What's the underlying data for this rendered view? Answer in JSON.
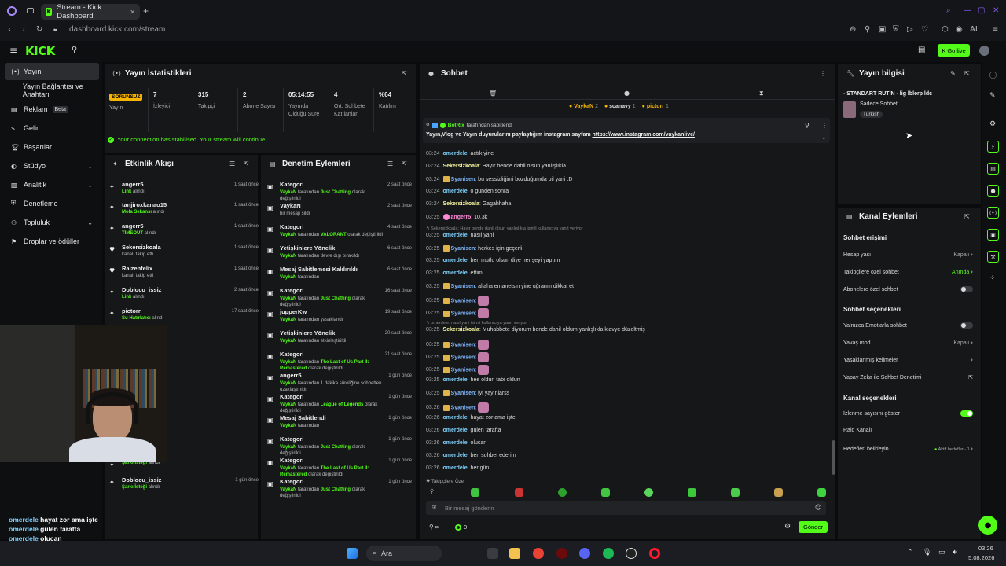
{
  "browser": {
    "tab_title": "Stream - Kick Dashboard",
    "url": "dashboard.kick.com/stream",
    "ai_label": "AI"
  },
  "header": {
    "logo": "KICK",
    "go_live": "Go live"
  },
  "sidebar": {
    "items": [
      {
        "label": "Yayın",
        "icon": "broadcast-icon",
        "active": true
      },
      {
        "label": "Yayın Bağlantısı ve Anahtarı",
        "icon": ""
      },
      {
        "label": "Reklam",
        "icon": "ad-icon",
        "badge": "Beta"
      },
      {
        "label": "Gelir",
        "icon": "revenue-icon"
      },
      {
        "label": "Başarılar",
        "icon": "trophy-icon"
      },
      {
        "label": "Stüdyo",
        "icon": "palette-icon",
        "chevron": true
      },
      {
        "label": "Analitik",
        "icon": "chart-icon",
        "chevron": true
      },
      {
        "label": "Denetleme",
        "icon": "shield-icon"
      },
      {
        "label": "Topluluk",
        "icon": "users-icon",
        "chevron": true
      },
      {
        "label": "Droplar ve ödüller",
        "icon": "gift-icon"
      }
    ]
  },
  "stats": {
    "title": "Yayın İstatistikleri",
    "status_badge": "SORUNSUZ",
    "status_label": "Yayın",
    "items": [
      {
        "value": "7",
        "label": "İzleyici"
      },
      {
        "value": "315",
        "label": "Takipçi"
      },
      {
        "value": "2",
        "label": "Abone Sayısı"
      },
      {
        "value": "05:14:55",
        "label": "Yayında Olduğu Süre"
      },
      {
        "value": "4",
        "label": "Ort. Sohbete Katılanlar"
      },
      {
        "value": "%64",
        "label": "Katılım"
      }
    ],
    "connection_msg": "Your connection has stabilised. Your stream will continue."
  },
  "activity": {
    "title": "Etkinlik Akışı",
    "items": [
      {
        "name": "angerr5",
        "b": "Link",
        "rest": " alındı",
        "time": "1 saat önce"
      },
      {
        "name": "tanjiroxkanao15",
        "b": "Mola Sekansı",
        "rest": " alındı",
        "time": "1 saat önce"
      },
      {
        "name": "angerr5",
        "b": "TIMEOUT",
        "rest": " alındı",
        "time": "1 saat önce"
      },
      {
        "name": "Sekersizkoala",
        "b": "",
        "rest": "kanalı takip etti",
        "time": "1 saat önce"
      },
      {
        "name": "Raizenfelix",
        "b": "",
        "rest": "kanalı takip etti",
        "time": "1 saat önce"
      },
      {
        "name": "Doblocu_issiz",
        "b": "Link",
        "rest": " alındı",
        "time": "2 saat önce"
      },
      {
        "name": "pictorr",
        "b": "Su Hatırlatıcı",
        "rest": " alındı",
        "time": "17 saat önce"
      },
      {
        "name": "",
        "b": "Şarkı İsteği",
        "rest": " alındı",
        "time": ""
      },
      {
        "name": "Doblocu_issiz",
        "b": "Şarkı İsteği",
        "rest": " alındı",
        "time": "1 gün önce"
      }
    ]
  },
  "moderation": {
    "title": "Denetim Eylemleri",
    "items": [
      {
        "name": "Kategori",
        "user": "VaykaN",
        "pre": " tarafından ",
        "b": "Just Chatting",
        "post": " olarak değiştirildi",
        "time": "2 saat önce"
      },
      {
        "name": "VaykaN",
        "user": "",
        "pre": "bir mesajı sildi",
        "b": "",
        "post": "",
        "time": "2 saat önce"
      },
      {
        "name": "Kategori",
        "user": "VaykaN",
        "pre": " tarafından ",
        "b": "VALORANT",
        "post": " olarak değiştirildi",
        "time": "4 saat önce"
      },
      {
        "name": "Yetişkinlere Yönelik",
        "user": "VaykaN",
        "pre": " tarafından devre dışı bırakıldı",
        "b": "",
        "post": "",
        "time": "6 saat önce"
      },
      {
        "name": "Mesaj Sabitlemesi Kaldırıldı",
        "user": "VaykaN",
        "pre": " tarafından",
        "b": "",
        "post": "",
        "time": "6 saat önce"
      },
      {
        "name": "Kategori",
        "user": "VaykaN",
        "pre": " tarafından ",
        "b": "Just Chatting",
        "post": " olarak değiştirildi",
        "time": "16 saat önce"
      },
      {
        "name": "jupperKw",
        "user": "VaykaN",
        "pre": " tarafından yasaklandı",
        "b": "",
        "post": "",
        "time": "19 saat önce"
      },
      {
        "name": "Yetişkinlere Yönelik",
        "user": "VaykaN",
        "pre": " tarafından etkinleştirildi",
        "b": "",
        "post": "",
        "time": "20 saat önce"
      },
      {
        "name": "Kategori",
        "user": "VaykaN",
        "pre": " tarafından ",
        "b": "The Last of Us Part II: Remastered",
        "post": " olarak değiştirildi",
        "time": "21 saat önce"
      },
      {
        "name": "angerr5",
        "user": "VaykaN",
        "pre": " tarafından 1 dakika süreliğine sohbetten uzaklaştırıldı",
        "b": "",
        "post": "",
        "time": "1 gün önce"
      },
      {
        "name": "Kategori",
        "user": "VaykaN",
        "pre": " tarafından ",
        "b": "League of Legends",
        "post": " olarak değiştirildi",
        "time": "1 gün önce"
      },
      {
        "name": "Mesaj Sabitlendi",
        "user": "VaykaN",
        "pre": " tarafından",
        "b": "",
        "post": "",
        "time": "1 gün önce"
      },
      {
        "name": "Kategori",
        "user": "VaykaN",
        "pre": " tarafından ",
        "b": "Just Chatting",
        "post": " olarak değiştirildi",
        "time": "1 gün önce"
      },
      {
        "name": "Kategori",
        "user": "VaykaN",
        "pre": " tarafından ",
        "b": "The Last of Us Part II: Remastered",
        "post": " olarak değiştirildi",
        "time": "1 gün önce"
      },
      {
        "name": "Kategori",
        "user": "VaykaN",
        "pre": " tarafından ",
        "b": "Just Chatting",
        "post": " olarak değiştirildi",
        "time": "1 gün önce"
      }
    ]
  },
  "chat": {
    "title": "Sohbet",
    "viewers": [
      {
        "name": "VaykaN",
        "n": "2"
      },
      {
        "name": "scanavy",
        "n": "1"
      },
      {
        "name": "pictorr",
        "n": "1"
      }
    ],
    "pinned": {
      "by": "BotRix",
      "by_suffix": " tarafından sabitlendi",
      "text": "Yayın,Vlog ve Yayın duyurularını paylaştığım instagram sayfam ",
      "link": "https://www.instagram.com/vaykanlive/"
    },
    "messages": [
      {
        "ts": "03:24",
        "user": "omerdele",
        "c": "#7fd3ff",
        "text": ": actık yine"
      },
      {
        "ts": "03:24",
        "user": "Sekersizkoala",
        "c": "#f5f5a0",
        "text": ": Hayır bende dahil olsun yanlışlıkla"
      },
      {
        "ts": "03:24",
        "user": "Syanisen",
        "c": "#7fb8ff",
        "badge": true,
        "text": ": bu sessizliğimi bozduğumda bil yani :D"
      },
      {
        "ts": "03:24",
        "user": "omerdele",
        "c": "#7fd3ff",
        "text": ": o gunden sonra"
      },
      {
        "ts": "03:24",
        "user": "Sekersizkoala",
        "c": "#f5f5a0",
        "text": ": Gagahhaha"
      },
      {
        "ts": "03:25",
        "user": "angerr5",
        "c": "#ff8ad8",
        "emoteBadge": true,
        "text": ": 10.3k"
      },
      {
        "reply": "Sekersizkoala: Hayır bende dahil olsun yanlışlıkla isimli kullanıcıya yanıt veriyor"
      },
      {
        "ts": "03:25",
        "user": "omerdele",
        "c": "#7fd3ff",
        "text": ": nasıl yani"
      },
      {
        "ts": "03:25",
        "user": "Syanisen",
        "c": "#7fb8ff",
        "badge": true,
        "text": ": herkes için geçerli"
      },
      {
        "ts": "03:25",
        "user": "omerdele",
        "c": "#7fd3ff",
        "text": ": ben mutlu olsun diye her şeyi yaptım"
      },
      {
        "ts": "03:25",
        "user": "omerdele",
        "c": "#7fd3ff",
        "text": ": ettim"
      },
      {
        "ts": "03:25",
        "user": "Syanisen",
        "c": "#7fb8ff",
        "badge": true,
        "text": ": allaha emanetsin yine uğrarım dikkat et"
      },
      {
        "ts": "03:25",
        "user": "Syanisen",
        "c": "#7fb8ff",
        "badge": true,
        "text": ": ",
        "emote": true
      },
      {
        "ts": "03:25",
        "user": "Syanisen",
        "c": "#7fb8ff",
        "badge": true,
        "text": ": ",
        "emote": true
      },
      {
        "reply": "omerdele: nasıl yani isimli kullanıcıya yanıt veriyor"
      },
      {
        "ts": "03:25",
        "user": "Sekersizkoala",
        "c": "#f5f5a0",
        "text": ": Muhabbete diyorum bende dahil oldum yanlışlıkla,klavye düzeltmiş"
      },
      {
        "ts": "03:25",
        "user": "Syanisen",
        "c": "#7fb8ff",
        "badge": true,
        "text": ": ",
        "emote": true
      },
      {
        "ts": "03:25",
        "user": "Syanisen",
        "c": "#7fb8ff",
        "badge": true,
        "text": ": ",
        "emote": true
      },
      {
        "ts": "03:25",
        "user": "Syanisen",
        "c": "#7fb8ff",
        "badge": true,
        "text": ": ",
        "emote": true
      },
      {
        "ts": "03:25",
        "user": "omerdele",
        "c": "#7fd3ff",
        "text": ": hee oldun tabi oldun"
      },
      {
        "ts": "03:25",
        "user": "Syanisen",
        "c": "#7fb8ff",
        "badge": true,
        "text": ": iyi yayınlarss"
      },
      {
        "ts": "03:26",
        "user": "Syanisen",
        "c": "#7fb8ff",
        "badge": true,
        "text": ": ",
        "emote": true
      },
      {
        "ts": "03:26",
        "user": "omerdele",
        "c": "#7fd3ff",
        "text": ": hayat zor ama işte"
      },
      {
        "ts": "03:26",
        "user": "omerdele",
        "c": "#7fd3ff",
        "text": ": gülen tarafta"
      },
      {
        "ts": "03:26",
        "user": "omerdele",
        "c": "#7fd3ff",
        "text": ": olucan"
      },
      {
        "ts": "03:26",
        "user": "omerdele",
        "c": "#7fd3ff",
        "text": ": ben sohbet ederim"
      },
      {
        "ts": "03:26",
        "user": "omerdele",
        "c": "#7fd3ff",
        "text": ": her gün"
      }
    ],
    "followers_only": "Takipçilere Özel",
    "input_placeholder": "Bir mesaj gönderin",
    "points": "0",
    "send": "Gönder"
  },
  "stream_info": {
    "title": "Yayın bilgisi",
    "stream_title": "- STANDART RUTİN - lig lblerp ldc",
    "category": "Sadece Sohbet",
    "language": "Turkish"
  },
  "channel_actions": {
    "title": "Kanal Eylemleri",
    "chat_access": "Sohbet erişimi",
    "age": {
      "label": "Hesap yaşı",
      "value": "Kapalı"
    },
    "followers_chat": {
      "label": "Takipçilere özel sohbet",
      "value": "Anında"
    },
    "subs_chat": {
      "label": "Abonelere özel sohbet"
    },
    "chat_options": "Sohbet seçenekleri",
    "emotes_only": {
      "label": "Yalnızca Emotlarla sohbet"
    },
    "slow": {
      "label": "Yavaş mod",
      "value": "Kapalı"
    },
    "banned": {
      "label": "Yasaklanmış kelimeler"
    },
    "ai": {
      "label": "Yapay Zeka ile Sohbet Denetimi"
    },
    "channel_options": "Kanal seçenekleri",
    "viewcount": {
      "label": "İzlenme sayısını göster"
    },
    "raid": {
      "label": "Raid Kanalı"
    },
    "goals": {
      "label": "Hedefleri belirleyin",
      "value": "Aktif hedefler - 1"
    }
  },
  "overlay": [
    {
      "u": "omerdele",
      "m": "hayat zor ama işte"
    },
    {
      "u": "omerdele",
      "m": "gülen tarafta"
    },
    {
      "u": "omerdele",
      "m": "olucan"
    },
    {
      "u": "omerdele",
      "m": "ben sohbet ederim"
    },
    {
      "u": "omerdele",
      "m": "her gün"
    }
  ],
  "taskbar": {
    "search": "Ara",
    "time": "03:26",
    "date": "5.08.2026"
  }
}
